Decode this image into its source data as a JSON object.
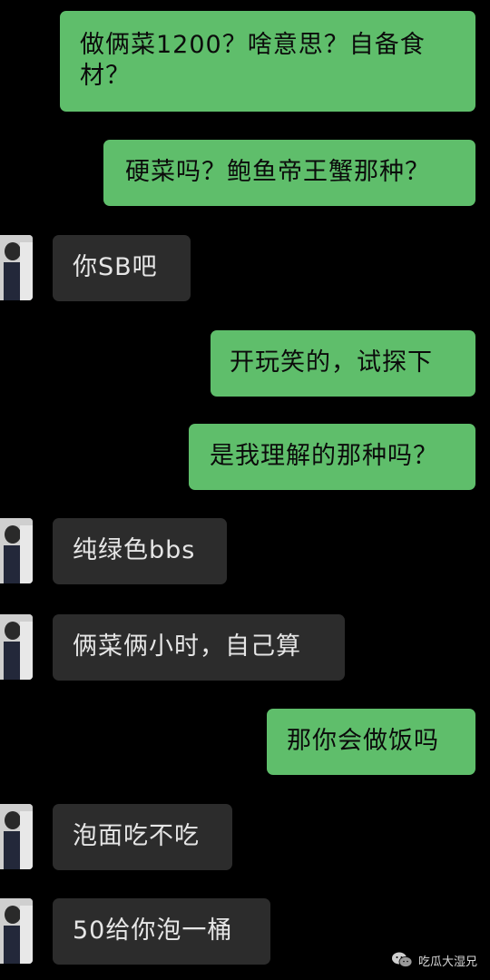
{
  "messages": [
    {
      "id": 1,
      "side": "out",
      "text": "做俩菜1200？啥意思？自备食材？"
    },
    {
      "id": 2,
      "side": "out",
      "text": "硬菜吗？鲍鱼帝王蟹那种？"
    },
    {
      "id": 3,
      "side": "in",
      "text": "你SB吧"
    },
    {
      "id": 4,
      "side": "out",
      "text": "开玩笑的，试探下"
    },
    {
      "id": 5,
      "side": "out",
      "text": "是我理解的那种吗？"
    },
    {
      "id": 6,
      "side": "in",
      "text": "纯绿色bbs"
    },
    {
      "id": 7,
      "side": "in",
      "text": "俩菜俩小时，自己算"
    },
    {
      "id": 8,
      "side": "out",
      "text": "那你会做饭吗"
    },
    {
      "id": 9,
      "side": "in",
      "text": "泡面吃不吃"
    },
    {
      "id": 10,
      "side": "in",
      "text": "50给你泡一桶"
    }
  ],
  "watermark": {
    "icon": "wechat-icon",
    "text": "吃瓜大湿兄"
  },
  "colors": {
    "background": "#000000",
    "outgoing_bubble": "#5fbe6b",
    "incoming_bubble": "#2c2c2c"
  }
}
